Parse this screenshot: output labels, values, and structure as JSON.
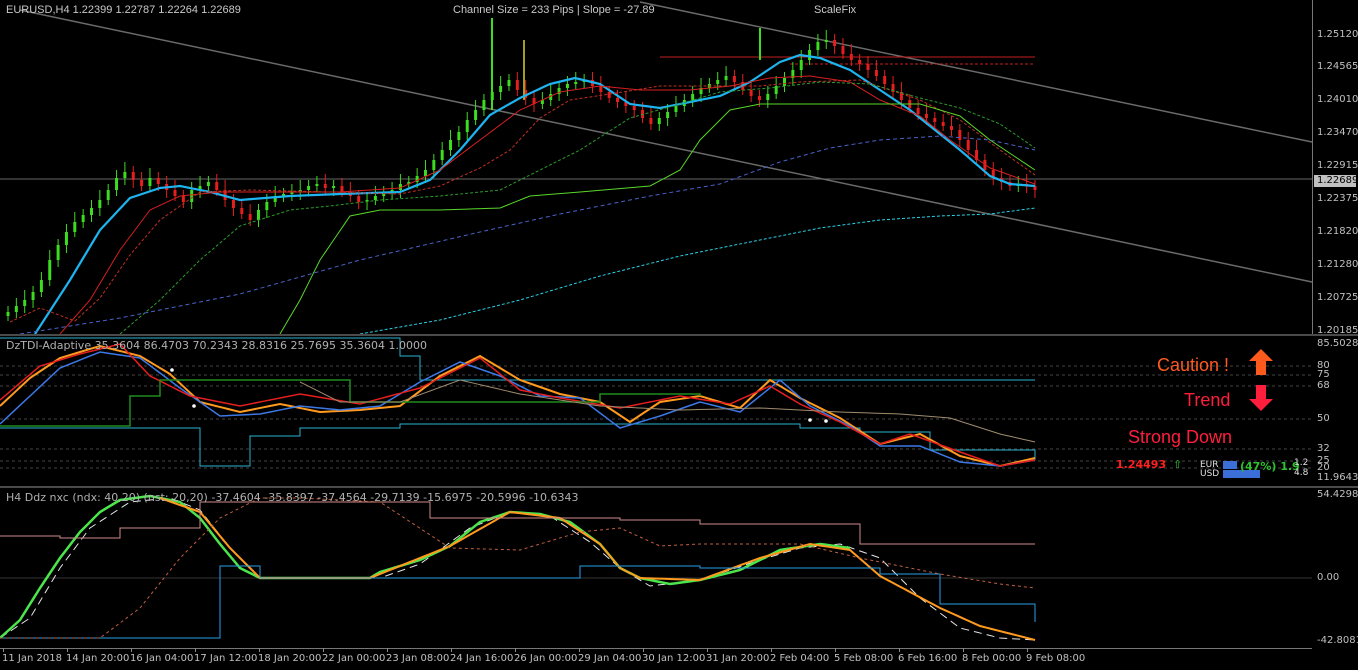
{
  "main": {
    "symbol_line": "EURUSD,H4  1.22399 1.22787 1.22264 1.22689",
    "channel_text": "Channel Size = 233 Pips  |  Slope = -27.89",
    "scale_text": "ScaleFix",
    "price_labels": [
      "1.25120",
      "1.24565",
      "1.24010",
      "1.23470",
      "1.22915",
      "1.22375",
      "1.21820",
      "1.21280",
      "1.20725",
      "1.20185"
    ],
    "current_price": "1.22689"
  },
  "tdi": {
    "title": "DzTDI-Adaptive 35.3604 86.4703 70.2343 28.8316 25.7695 35.3604 1.0000",
    "levels": [
      "85.5028",
      "80",
      "75",
      "68",
      "50",
      "32",
      "25",
      "20",
      "11.9643"
    ],
    "caution_text": "Caution !",
    "trend_text": "Trend",
    "strong_text": "Strong Down",
    "value_text": "1.24493",
    "eur_label": "EUR",
    "usd_label": "USD",
    "pct_text": "(47%) 1.9",
    "eur_val": "1.2",
    "usd_val": "4.8",
    "caution_color": "#ff5a1e",
    "down_color": "#ff1e3c"
  },
  "nxc": {
    "title": "H4 Ddz nxc (ndx: 40,20) (nst: 20,20) -37.4604 -35.8397 -37.4564 -29.7139 -15.6975 -20.5996 -10.6343",
    "levels": [
      "54.4298",
      "0.00",
      "-42.8081"
    ]
  },
  "time_axis": [
    "11 Jan 2018",
    "14 Jan 20:00",
    "16 Jan 04:00",
    "17 Jan 12:00",
    "18 Jan 20:00",
    "22 Jan 00:00",
    "23 Jan 08:00",
    "24 Jan 16:00",
    "26 Jan 00:00",
    "29 Jan 04:00",
    "30 Jan 12:00",
    "31 Jan 20:00",
    "2 Feb 04:00",
    "5 Feb 08:00",
    "6 Feb 16:00",
    "8 Feb 00:00",
    "9 Feb 08:00"
  ],
  "icons": [
    "caution-up-arrow-icon",
    "trend-down-arrow-icon",
    "small-up-arrow-icon"
  ]
}
